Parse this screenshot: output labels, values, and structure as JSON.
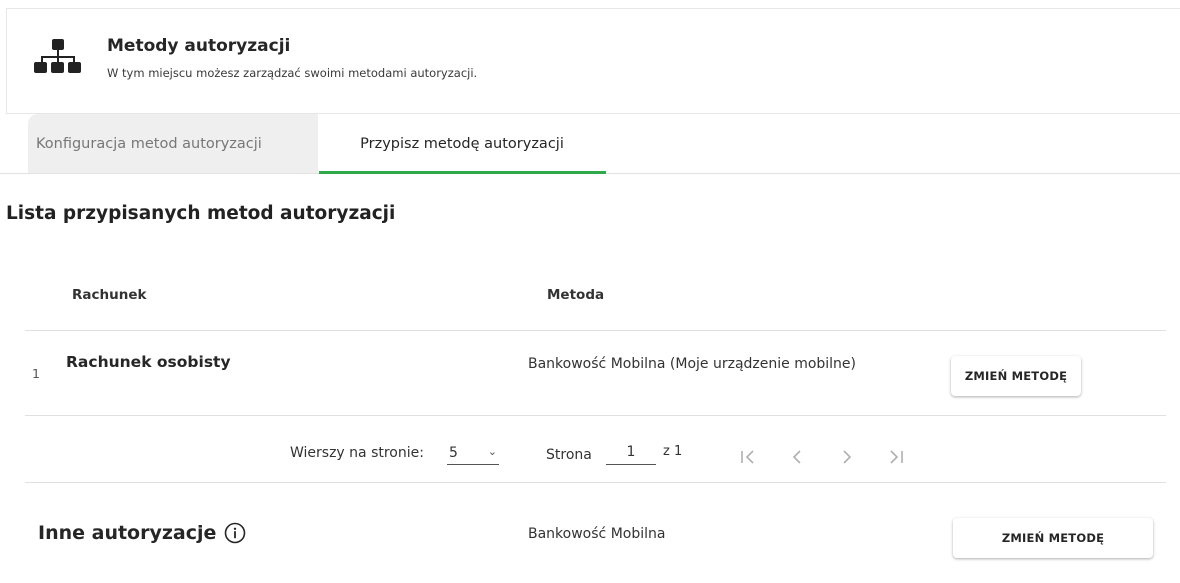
{
  "header": {
    "icon": "sitemap-icon",
    "title": "Metody autoryzacji",
    "subtitle": "W tym miejscu możesz zarządzać swoimi metodami autoryzacji."
  },
  "tabs": [
    {
      "label": "Konfiguracja metod autoryzacji",
      "active": false
    },
    {
      "label": "Przypisz metodę autoryzacji",
      "active": true
    }
  ],
  "accent_color": "#2eaa4a",
  "section_title": "Lista przypisanych metod autoryzacji",
  "table": {
    "columns": [
      "Rachunek",
      "Metoda"
    ],
    "rows": [
      {
        "num": "1",
        "account": "Rachunek osobisty",
        "method": "Bankowość Mobilna (Moje urządzenie mobilne)",
        "action": "ZMIEŃ METODĘ"
      }
    ]
  },
  "pagination": {
    "rows_per_page_label": "Wierszy na stronie:",
    "rows_per_page": "5",
    "page_label": "Strona",
    "page": "1",
    "of_label": "z 1",
    "icons": [
      "first-page-icon",
      "prev-page-icon",
      "next-page-icon",
      "last-page-icon"
    ]
  },
  "other": {
    "title": "Inne autoryzacje",
    "icon": "info-icon",
    "method": "Bankowość Mobilna",
    "action": "ZMIEŃ METODĘ"
  }
}
